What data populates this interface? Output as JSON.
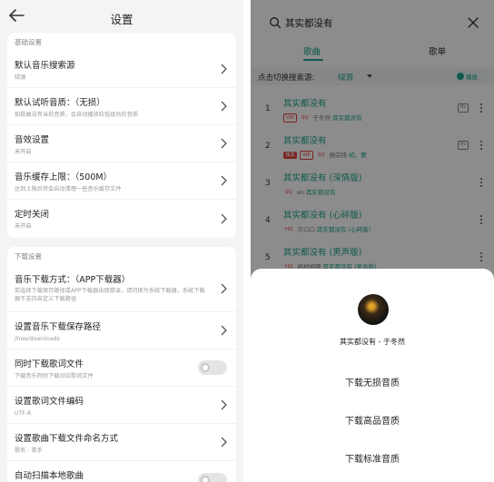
{
  "left": {
    "title": "设置",
    "sections": [
      {
        "header": "基础设置",
        "rows": [
          {
            "title": "默认音乐搜索源",
            "sub": "绿源",
            "control": "chevron"
          },
          {
            "title": "默认试听音质：（无损）",
            "sub": "如歌曲没有当前音质，会自动播放较低级别的音质",
            "control": "chevron"
          },
          {
            "title": "音效设置",
            "sub": "未开启",
            "control": "chevron"
          },
          {
            "title": "音乐缓存上限：（500M）",
            "sub": "达到上限后将会自动清理一些音乐缓存文件",
            "control": "chevron"
          },
          {
            "title": "定时关闭",
            "sub": "未开启",
            "control": "chevron"
          }
        ]
      },
      {
        "header": "下载设置",
        "rows": [
          {
            "title": "音乐下载方式：（APP下载器）",
            "sub": "若选择下载保存路径或APP下载器出现错误，请切换为系统下载器，系统下载器不支持自定义下载路径",
            "control": "chevron",
            "tall": true
          },
          {
            "title": "设置音乐下载保存路径",
            "sub": "/tree/downloads",
            "control": "chevron"
          },
          {
            "title": "同时下载歌词文件",
            "sub": "下载音乐同时下载对应歌词文件",
            "control": "toggle",
            "on": false
          },
          {
            "title": "设置歌词文件编码",
            "sub": "UTF-8",
            "control": "chevron"
          },
          {
            "title": "设置歌曲下载文件命名方式",
            "sub": "歌名 - 歌手",
            "control": "chevron"
          },
          {
            "title": "自动扫描本地歌曲",
            "sub": "",
            "control": "toggle",
            "on": false
          }
        ]
      }
    ]
  },
  "right": {
    "search_query": "其实都没有",
    "tabs": [
      "歌曲",
      "歌单"
    ],
    "active_tab": 0,
    "source_label": "点击切换搜索源:",
    "source_value": "绿源",
    "play_all_label": "播放",
    "songs": [
      {
        "num": "1",
        "title": "其实都没有",
        "badges": [
          {
            "t": "VIP",
            "k": "vip"
          },
          {
            "t": "SQ",
            "k": "q"
          }
        ],
        "artist": "于冬然",
        "album": "其实都没有",
        "mv": true
      },
      {
        "num": "2",
        "title": "其实都没有",
        "badges": [
          {
            "t": "独家",
            "k": "solid"
          },
          {
            "t": "VIP",
            "k": "vip"
          },
          {
            "t": "SQ",
            "k": "q"
          }
        ],
        "artist": "杨宗纬",
        "album": "初。要",
        "mv": true
      },
      {
        "num": "3",
        "title": "其实都没有 (深情版)",
        "badges": [
          {
            "t": "SQ",
            "k": "q"
          }
        ],
        "artist": "en",
        "album": "其实都没有",
        "mv": false
      },
      {
        "num": "4",
        "title": "其实都没有 (心碎版)",
        "badges": [
          {
            "t": "HQ",
            "k": "q"
          }
        ],
        "artist": "贝口口",
        "album": "其实都没有 (心碎版)",
        "mv": false
      },
      {
        "num": "5",
        "title": "其实都没有 (男声版)",
        "badges": [
          {
            "t": "HQ",
            "k": "q"
          }
        ],
        "artist": "柯柯柯啊",
        "album": "其实都没有 (男声版)",
        "mv": false
      }
    ],
    "sheet": {
      "song_line": "其实都没有 - 于冬然",
      "options": [
        "下载无损音质",
        "下载高品音质",
        "下载标准音质"
      ]
    }
  }
}
